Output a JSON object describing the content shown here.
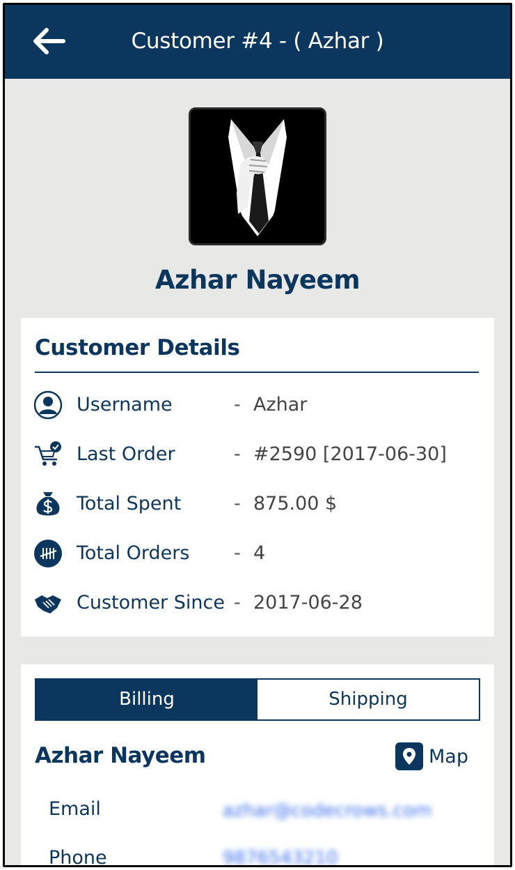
{
  "app_bar": {
    "title": "Customer #4 - ( Azhar )",
    "back_icon": "arrow-left-icon",
    "color": "#0b365e"
  },
  "profile": {
    "avatar_icon": "suit-and-tie-avatar",
    "name": "Azhar Nayeem"
  },
  "details": {
    "title": "Customer Details",
    "rows": [
      {
        "icon": "user-icon",
        "label": "Username",
        "separator": "-",
        "value": "Azhar"
      },
      {
        "icon": "cart-check-icon",
        "label": "Last Order",
        "separator": "-",
        "value": "#2590 [2017-06-30]"
      },
      {
        "icon": "money-bag-icon",
        "label": "Total Spent",
        "separator": "-",
        "value": "875.00 $"
      },
      {
        "icon": "tally-icon",
        "label": "Total Orders",
        "separator": "-",
        "value": "4"
      },
      {
        "icon": "handshake-icon",
        "label": "Customer Since",
        "separator": "-",
        "value": "2017-06-28"
      }
    ]
  },
  "address": {
    "tabs": [
      {
        "label": "Billing",
        "active": true
      },
      {
        "label": "Shipping",
        "active": false
      }
    ],
    "name": "Azhar Nayeem",
    "map_label": "Map",
    "map_icon": "map-pin-icon",
    "fields": [
      {
        "label": "Email",
        "value": "azhar@codecrows.com"
      },
      {
        "label": "Phone",
        "value": "9876543210"
      }
    ]
  }
}
